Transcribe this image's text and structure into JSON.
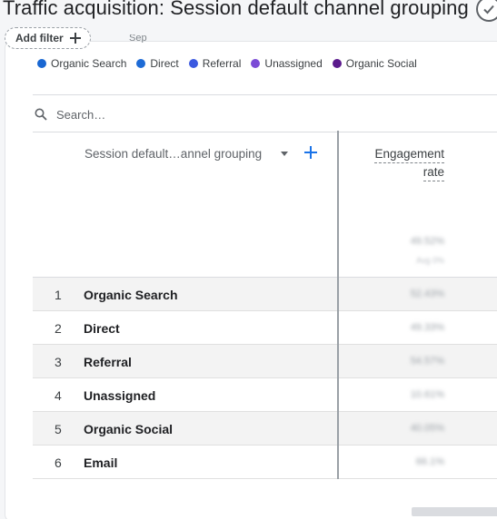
{
  "header": {
    "title": "Traffic acquisition: Session default channel grouping"
  },
  "filters": {
    "add_filter_label": "Add filter",
    "month_fragment": "Sep"
  },
  "legend": {
    "items": [
      {
        "label": "Organic Search",
        "color": "#1967d2"
      },
      {
        "label": "Direct",
        "color": "#1e6bd6"
      },
      {
        "label": "Referral",
        "color": "#3b59e0"
      },
      {
        "label": "Unassigned",
        "color": "#7b4bd6"
      },
      {
        "label": "Organic Social",
        "color": "#5b1a8c"
      }
    ]
  },
  "search": {
    "placeholder": "Search…"
  },
  "table": {
    "dimension_header": "Session default…annel grouping",
    "metric_header_line1": "Engagement",
    "metric_header_line2": "rate",
    "total_value": "49.52%",
    "total_sub": "Avg 0%",
    "rows": [
      {
        "index": "1",
        "name": "Organic Search",
        "value": "52.43%"
      },
      {
        "index": "2",
        "name": "Direct",
        "value": "49.33%"
      },
      {
        "index": "3",
        "name": "Referral",
        "value": "54.57%"
      },
      {
        "index": "4",
        "name": "Unassigned",
        "value": "10.61%"
      },
      {
        "index": "5",
        "name": "Organic Social",
        "value": "40.05%"
      },
      {
        "index": "6",
        "name": "Email",
        "value": "66.1%"
      }
    ]
  },
  "icons": {
    "check": "check-circle-icon",
    "search": "search-icon",
    "add": "plus-icon",
    "sort": "caret-down-icon"
  }
}
